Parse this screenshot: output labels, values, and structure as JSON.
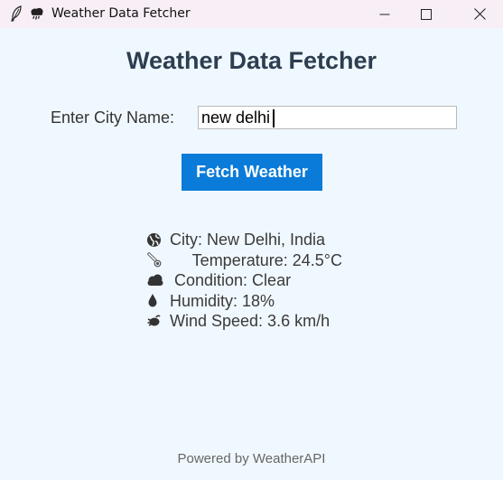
{
  "window": {
    "title": "Weather Data Fetcher",
    "icons": [
      "feather-icon",
      "storm-cloud-icon"
    ],
    "controls": [
      "minimize-icon",
      "maximize-icon",
      "close-icon"
    ]
  },
  "app": {
    "heading": "Weather Data Fetcher",
    "city_label": "Enter City Name:",
    "city_value": "new delhi",
    "fetch_button": "Fetch Weather",
    "results": {
      "city": "City: New Delhi, India",
      "temperature": "     Temperature: 24.5°C",
      "condition": " Condition: Clear",
      "humidity": "Humidity: 18%",
      "wind": "Wind Speed: 3.6 km/h"
    },
    "result_icons": [
      "globe-icon",
      "thermometer-icon",
      "cloud-icon",
      "droplet-icon",
      "wind-icon"
    ],
    "footer": "Powered by WeatherAPI"
  },
  "colors": {
    "background": "#f0f8ff",
    "titlebar": "#f7eef6",
    "heading": "#2c3e50",
    "button": "#0a7bd8",
    "button_text": "#ffffff"
  }
}
